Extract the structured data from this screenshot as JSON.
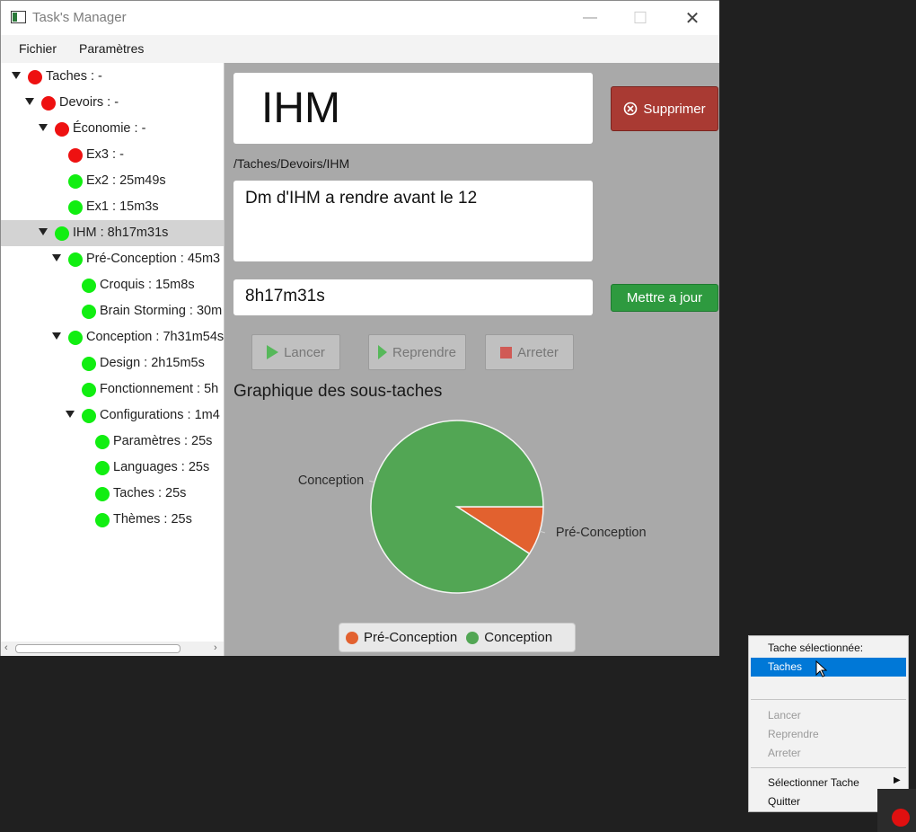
{
  "window": {
    "title": "Task's Manager"
  },
  "menu": [
    "Fichier",
    "Paramètres"
  ],
  "tree": [
    {
      "label": "Taches : -",
      "color": "#ee1111",
      "depth": 0,
      "expanded": true
    },
    {
      "label": "Devoirs : -",
      "color": "#ee1111",
      "depth": 1,
      "expanded": true
    },
    {
      "label": "Économie : -",
      "color": "#ee1111",
      "depth": 2,
      "expanded": true
    },
    {
      "label": "Ex3 : -",
      "color": "#ee1111",
      "depth": 3
    },
    {
      "label": "Ex2 : 25m49s",
      "color": "#11ee11",
      "depth": 3
    },
    {
      "label": "Ex1 : 15m3s",
      "color": "#11ee11",
      "depth": 3
    },
    {
      "label": "IHM : 8h17m31s",
      "color": "#11ee11",
      "depth": 2,
      "expanded": true,
      "selected": true
    },
    {
      "label": "Pré-Conception : 45m3",
      "color": "#11ee11",
      "depth": 3,
      "expanded": true
    },
    {
      "label": "Croquis : 15m8s",
      "color": "#11ee11",
      "depth": 4
    },
    {
      "label": "Brain Storming : 30m",
      "color": "#11ee11",
      "depth": 4
    },
    {
      "label": "Conception : 7h31m54s",
      "color": "#11ee11",
      "depth": 3,
      "expanded": true
    },
    {
      "label": "Design : 2h15m5s",
      "color": "#11ee11",
      "depth": 4
    },
    {
      "label": "Fonctionnement : 5h",
      "color": "#11ee11",
      "depth": 4
    },
    {
      "label": "Configurations : 1m4",
      "color": "#11ee11",
      "depth": 4,
      "expanded": true
    },
    {
      "label": "Paramètres : 25s",
      "color": "#11ee11",
      "depth": 5
    },
    {
      "label": "Languages : 25s",
      "color": "#11ee11",
      "depth": 5
    },
    {
      "label": "Taches : 25s",
      "color": "#11ee11",
      "depth": 5
    },
    {
      "label": "Thèmes : 25s",
      "color": "#11ee11",
      "depth": 5
    }
  ],
  "detail": {
    "name": "IHM",
    "path": "/Taches/Devoirs/IHM",
    "description": "Dm d'IHM a rendre avant le 12",
    "time": "8h17m31s",
    "delete_label": "Supprimer",
    "update_label": "Mettre a jour",
    "launch_label": "Lancer",
    "resume_label": "Reprendre",
    "stop_label": "Arreter",
    "graph_title": "Graphique des sous-taches"
  },
  "chart_data": {
    "type": "pie",
    "title": "",
    "labels": [
      "Pré-Conception",
      "Conception"
    ],
    "values": [
      45.5,
      451.9
    ],
    "colors": [
      "#e2612f",
      "#52a654"
    ],
    "legend": "bottom"
  },
  "context_menu": {
    "header": "Tache sélectionnée:",
    "selected": "Taches",
    "launch": "Lancer",
    "resume": "Reprendre",
    "stop": "Arreter",
    "select_task": "Sélectionner Tache",
    "quit": "Quitter"
  }
}
